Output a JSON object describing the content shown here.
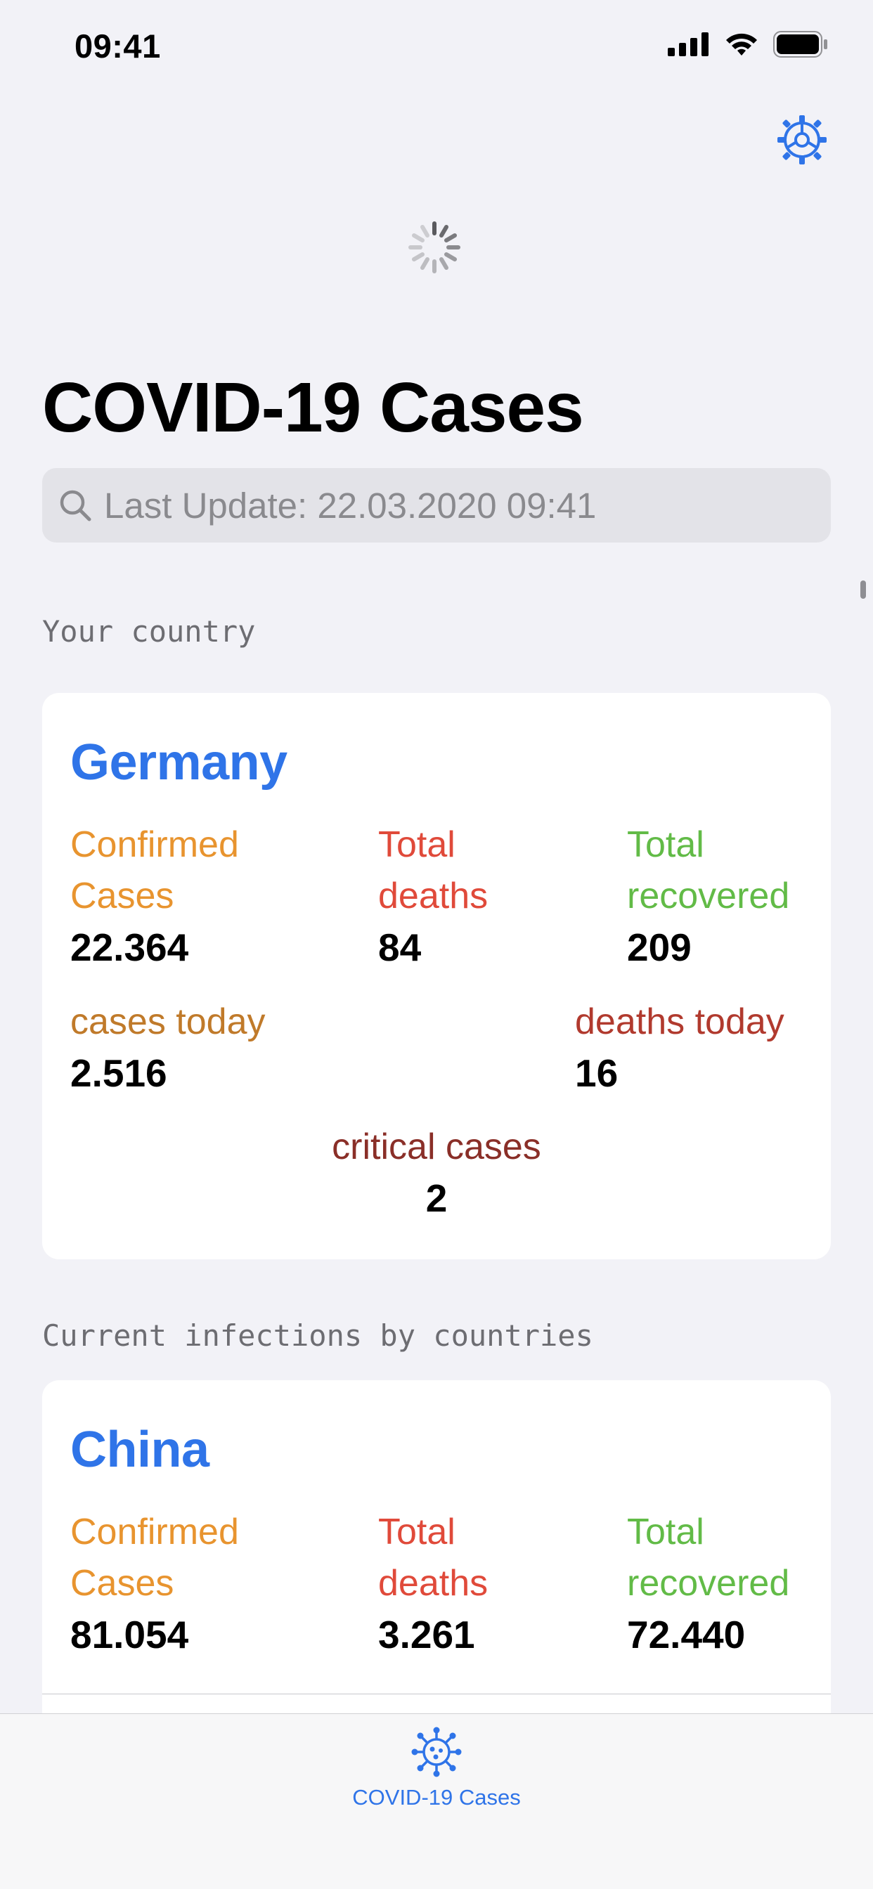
{
  "status_bar": {
    "time": "09:41"
  },
  "header": {
    "title": "COVID-19 Cases",
    "search_text": "Last Update: 22.03.2020 09:41"
  },
  "sections": {
    "your_country": "Your country",
    "by_countries": "Current infections by countries"
  },
  "labels": {
    "confirmed_1": "Confirmed",
    "confirmed_2": "Cases",
    "deaths_1": "Total",
    "deaths_2": "deaths",
    "recovered_1": "Total",
    "recovered_2": "recovered",
    "cases_today": "cases today",
    "deaths_today": "deaths today",
    "critical": "critical cases"
  },
  "your_country": {
    "name": "Germany",
    "confirmed": "22.364",
    "deaths": "84",
    "recovered": "209",
    "cases_today": "2.516",
    "deaths_today": "16",
    "critical": "2"
  },
  "countries": [
    {
      "name": "China",
      "confirmed": "81.054",
      "deaths": "3.261",
      "recovered": "72.440"
    }
  ],
  "tabbar": {
    "tab_label": "COVID-19 Cases"
  },
  "colors": {
    "accent": "#2f74e8",
    "confirmed": "#e8942f",
    "deaths": "#e04a3a",
    "recovered": "#62bb47",
    "cases_today": "#c07a2a",
    "deaths_today": "#b13a2e",
    "critical": "#8a2f28"
  },
  "icons": {
    "settings": "gear-icon",
    "search": "search-icon",
    "loading": "spinner-icon",
    "tab": "virus-icon"
  }
}
